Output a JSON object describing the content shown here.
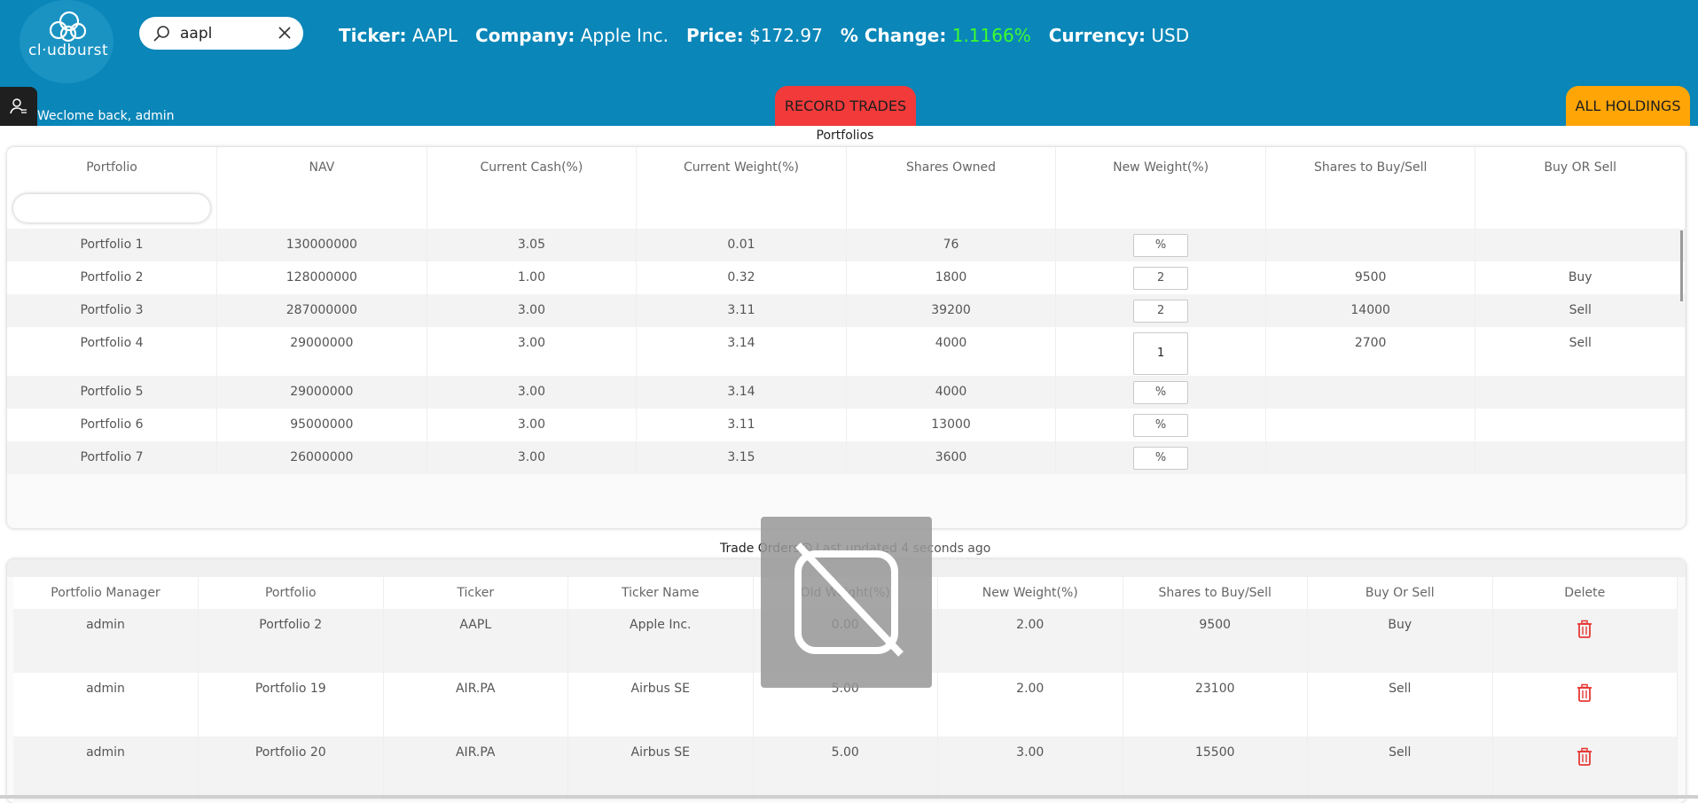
{
  "header": {
    "logo_text": "cl·udburst",
    "search": {
      "value": "aapl"
    },
    "ticker_label": "Ticker:",
    "ticker_value": "AAPL",
    "company_label": "Company:",
    "company_value": "Apple Inc.",
    "price_label": "Price:",
    "price_value": "$172.97",
    "change_label": "% Change:",
    "change_value": "1.1166%",
    "currency_label": "Currency:",
    "currency_value": "USD",
    "welcome": "Weclome back, admin",
    "record_trades": "RECORD TRADES",
    "all_holdings": "ALL HOLDINGS",
    "colors": {
      "bar": "#0a86b8",
      "record": "#f23a3a",
      "holdings": "#ffa506",
      "positive": "#3cff2e"
    }
  },
  "portfolios": {
    "title": "Portfolios",
    "columns": [
      "Portfolio",
      "NAV",
      "Current Cash(%)",
      "Current Weight(%)",
      "Shares Owned",
      "New Weight(%)",
      "Shares to Buy/Sell",
      "Buy OR Sell"
    ],
    "rows": [
      {
        "portfolio": "Portfolio 1",
        "nav": "130000000",
        "cash": "3.05",
        "weight": "0.01",
        "shares": "76",
        "new_weight": "%",
        "to_trade": "",
        "side": ""
      },
      {
        "portfolio": "Portfolio 2",
        "nav": "128000000",
        "cash": "1.00",
        "weight": "0.32",
        "shares": "1800",
        "new_weight": "2",
        "to_trade": "9500",
        "side": "Buy"
      },
      {
        "portfolio": "Portfolio 3",
        "nav": "287000000",
        "cash": "3.00",
        "weight": "3.11",
        "shares": "39200",
        "new_weight": "2",
        "to_trade": "14000",
        "side": "Sell"
      },
      {
        "portfolio": "Portfolio 4",
        "nav": "29000000",
        "cash": "3.00",
        "weight": "3.14",
        "shares": "4000",
        "new_weight": "1",
        "to_trade": "2700",
        "side": "Sell"
      },
      {
        "portfolio": "Portfolio 5",
        "nav": "29000000",
        "cash": "3.00",
        "weight": "3.14",
        "shares": "4000",
        "new_weight": "%",
        "to_trade": "",
        "side": ""
      },
      {
        "portfolio": "Portfolio 6",
        "nav": "95000000",
        "cash": "3.00",
        "weight": "3.11",
        "shares": "13000",
        "new_weight": "%",
        "to_trade": "",
        "side": ""
      },
      {
        "portfolio": "Portfolio 7",
        "nav": "26000000",
        "cash": "3.00",
        "weight": "3.15",
        "shares": "3600",
        "new_weight": "%",
        "to_trade": "",
        "side": ""
      }
    ]
  },
  "trade_orders": {
    "title": "Trade Orders",
    "last_updated": "Last updated 4 seconds ago",
    "columns": [
      "Portfolio Manager",
      "Portfolio",
      "Ticker",
      "Ticker Name",
      "Old Weight(%)",
      "New Weight(%)",
      "Shares to Buy/Sell",
      "Buy Or Sell",
      "Delete"
    ],
    "rows": [
      {
        "manager": "admin",
        "portfolio": "Portfolio 2",
        "ticker": "AAPL",
        "name": "Apple Inc.",
        "old": "0.00",
        "new": "2.00",
        "shares": "9500",
        "side": "Buy"
      },
      {
        "manager": "admin",
        "portfolio": "Portfolio 19",
        "ticker": "AIR.PA",
        "name": "Airbus SE",
        "old": "5.00",
        "new": "2.00",
        "shares": "23100",
        "side": "Sell"
      },
      {
        "manager": "admin",
        "portfolio": "Portfolio 20",
        "ticker": "AIR.PA",
        "name": "Airbus SE",
        "old": "5.00",
        "new": "3.00",
        "shares": "15500",
        "side": "Sell"
      }
    ]
  }
}
